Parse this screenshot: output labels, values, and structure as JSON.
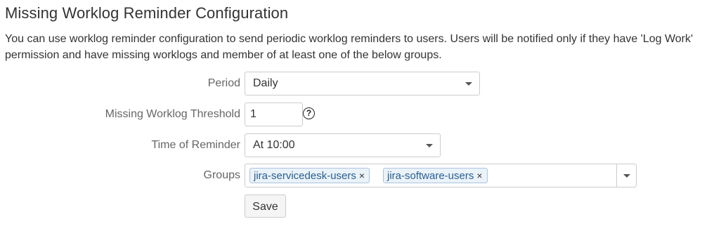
{
  "page": {
    "title": "Missing Worklog Reminder Configuration",
    "description": "You can use worklog reminder configuration to send periodic worklog reminders to users. Users will be notified only if they have 'Log Work' permission and have missing worklogs and member of at least one of the below groups."
  },
  "form": {
    "period": {
      "label": "Period",
      "value": "Daily"
    },
    "threshold": {
      "label": "Missing Worklog Threshold",
      "value": "1",
      "help": "?"
    },
    "time_of_reminder": {
      "label": "Time of Reminder",
      "value": "At 10:00"
    },
    "groups": {
      "label": "Groups",
      "selected": [
        "jira-servicedesk-users",
        "jira-software-users"
      ],
      "remove_symbol": "×"
    },
    "save_label": "Save"
  },
  "icons": {
    "dropdown": "chevron-down-icon",
    "help": "help-icon",
    "remove": "close-icon"
  }
}
